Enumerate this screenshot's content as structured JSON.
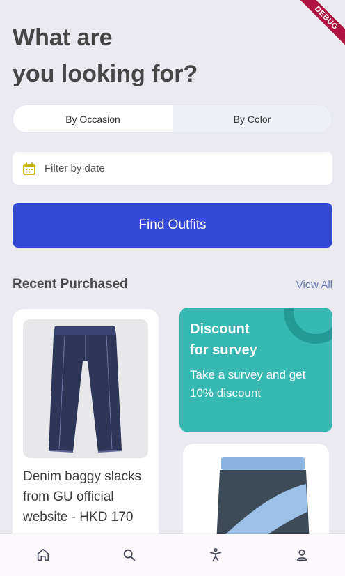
{
  "debug_banner": "DEBUG",
  "header": {
    "line1": "What are",
    "line2": "you looking for?"
  },
  "segments": [
    {
      "label": "By Occasion",
      "selected": true
    },
    {
      "label": "By Color",
      "selected": false
    }
  ],
  "date_filter": {
    "placeholder": "Filter by date",
    "icon": "calendar-icon"
  },
  "find_button": {
    "label": "Find Outfits"
  },
  "recent": {
    "title": "Recent Purchased",
    "view_all": "View All",
    "items": [
      {
        "caption": "Denim baggy slacks from GU official website - HKD 170"
      }
    ]
  },
  "promo": {
    "title_line1": "Discount",
    "title_line2": "for survey",
    "body": "Take a survey and get 10% discount"
  },
  "nav": [
    {
      "name": "home",
      "icon": "home-icon"
    },
    {
      "name": "search",
      "icon": "search-icon"
    },
    {
      "name": "accessibility",
      "icon": "accessibility-icon"
    },
    {
      "name": "profile",
      "icon": "profile-icon"
    }
  ],
  "colors": {
    "primary": "#3349d6",
    "promo": "#38b8b3",
    "background": "#ebeaf0"
  }
}
